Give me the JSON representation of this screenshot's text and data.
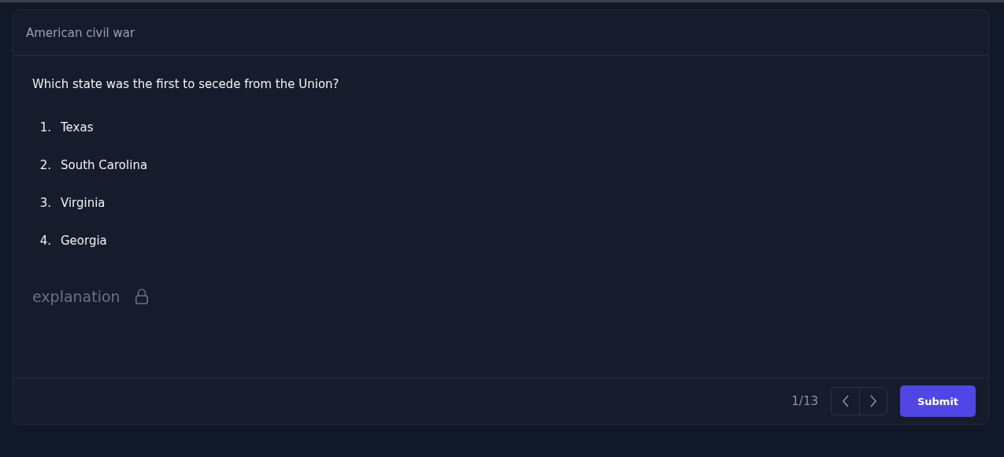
{
  "card": {
    "title": "American civil war"
  },
  "question": "Which state was the first to secede from the Union?",
  "options": [
    {
      "number": "1.",
      "text": "Texas"
    },
    {
      "number": "2.",
      "text": "South Carolina"
    },
    {
      "number": "3.",
      "text": "Virginia"
    },
    {
      "number": "4.",
      "text": "Georgia"
    }
  ],
  "explanation": {
    "label": "explanation",
    "locked": true
  },
  "footer": {
    "counter": "1/13",
    "submit": "Submit"
  }
}
